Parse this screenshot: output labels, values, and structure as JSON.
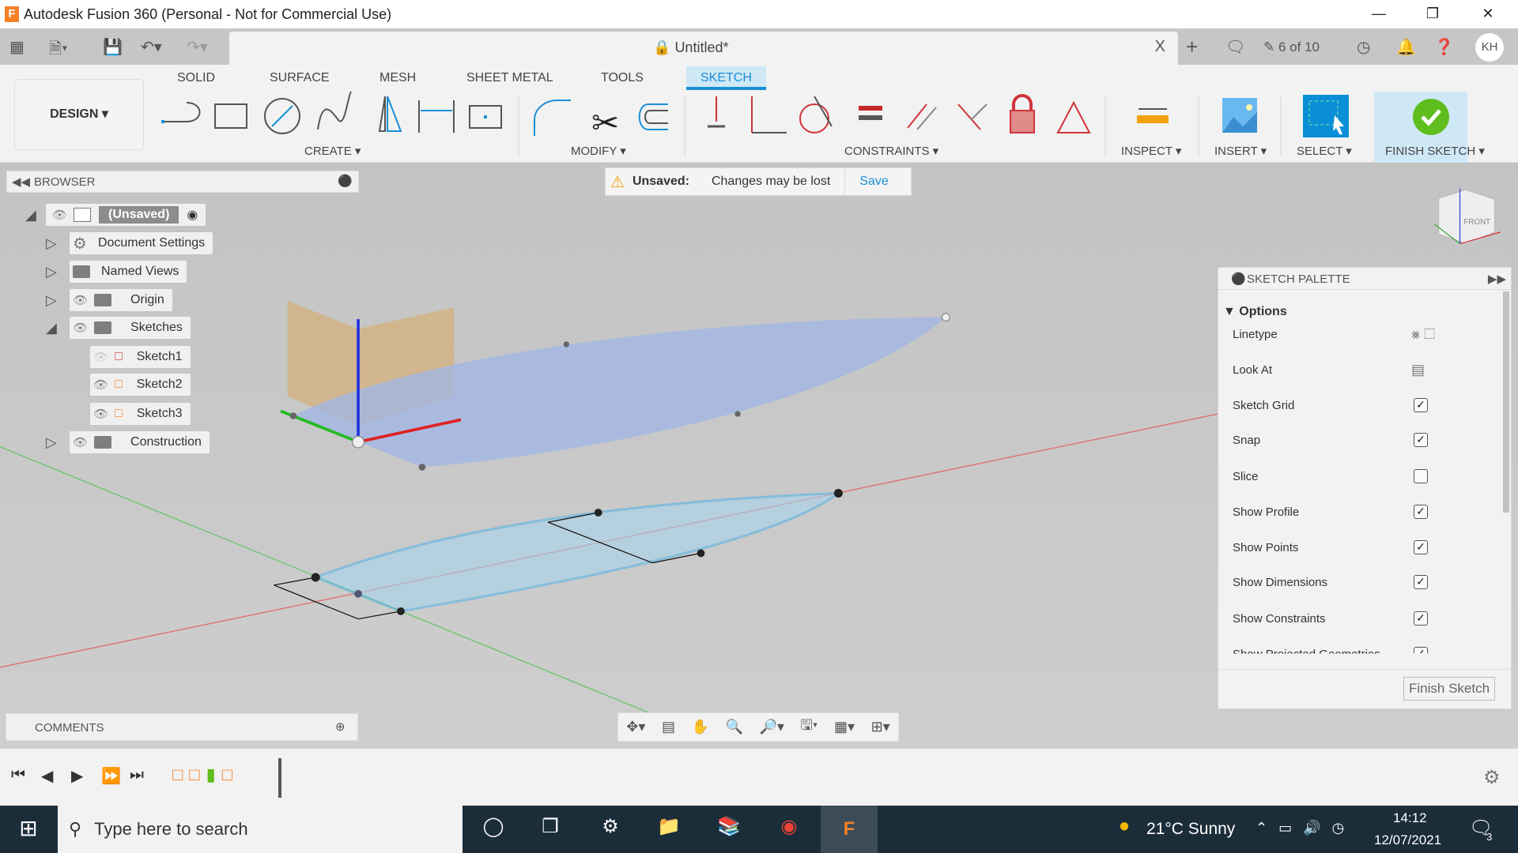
{
  "window": {
    "title": "Autodesk Fusion 360 (Personal - Not for Commercial Use)",
    "logo": "F"
  },
  "toolbar": {
    "doc_title": "Untitled*",
    "close": "X",
    "jobs": "6 of 10",
    "user_initials": "KH"
  },
  "ribbon": {
    "workspace": "DESIGN",
    "tabs": [
      "SOLID",
      "SURFACE",
      "MESH",
      "SHEET METAL",
      "TOOLS",
      "SKETCH"
    ],
    "active_tab": "SKETCH",
    "groups": {
      "create": "CREATE",
      "modify": "MODIFY",
      "constraints": "CONSTRAINTS",
      "inspect": "INSPECT",
      "insert": "INSERT",
      "select": "SELECT",
      "finish": "FINISH SKETCH"
    }
  },
  "browser": {
    "title": "BROWSER",
    "items": [
      {
        "label": "(Unsaved)"
      },
      {
        "label": "Document Settings"
      },
      {
        "label": "Named Views"
      },
      {
        "label": "Origin"
      },
      {
        "label": "Sketches"
      },
      {
        "label": "Sketch1"
      },
      {
        "label": "Sketch2"
      },
      {
        "label": "Sketch3"
      },
      {
        "label": "Construction"
      }
    ]
  },
  "notice": {
    "label": "Unsaved:",
    "message": "Changes may be lost",
    "save": "Save"
  },
  "palette": {
    "title": "SKETCH PALETTE",
    "section": "Options",
    "rows": [
      {
        "label": "Linetype"
      },
      {
        "label": "Look At"
      },
      {
        "label": "Sketch Grid",
        "checked": true
      },
      {
        "label": "Snap",
        "checked": true
      },
      {
        "label": "Slice",
        "checked": false
      },
      {
        "label": "Show Profile",
        "checked": true
      },
      {
        "label": "Show Points",
        "checked": true
      },
      {
        "label": "Show Dimensions",
        "checked": true
      },
      {
        "label": "Show Constraints",
        "checked": true
      },
      {
        "label": "Show Projected Geometries",
        "checked": true
      }
    ],
    "finish": "Finish Sketch"
  },
  "comments": {
    "title": "COMMENTS"
  },
  "viewcube": {
    "face": "FRONT"
  },
  "taskbar": {
    "search_placeholder": "Type here to search",
    "weather": "21°C  Sunny",
    "time": "14:12",
    "date": "12/07/2021",
    "notifications": "3"
  },
  "colors": {
    "accent": "#1a8fd6",
    "finish": "#5fbe1e",
    "constraint": "#d0343a"
  }
}
